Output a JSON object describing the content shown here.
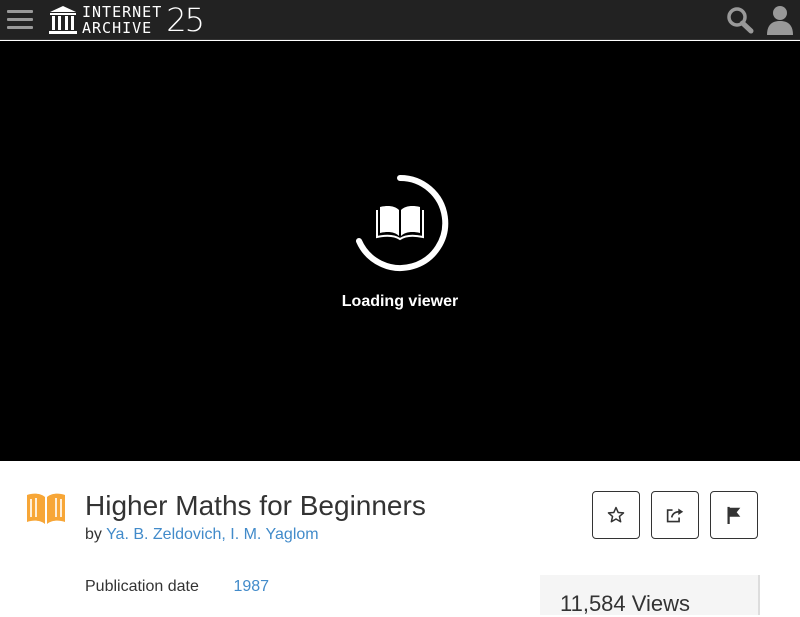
{
  "nav": {
    "logo_line1": "INTERNET",
    "logo_line2": "ARCHIVE",
    "logo_badge": "25",
    "icons": {
      "menu": "hamburger-icon",
      "search": "search-icon",
      "user": "user-icon"
    }
  },
  "viewer": {
    "status": "Loading viewer",
    "icon": "book-icon"
  },
  "item": {
    "title": "Higher Maths for Beginners",
    "by_prefix": "by",
    "authors": "Ya. B. Zeldovich, I. M. Yaglom",
    "type_icon": "texts-icon",
    "type_color": "#f7a637"
  },
  "actions": {
    "favorite_icon": "star-icon",
    "share_icon": "share-icon",
    "flag_icon": "flag-icon"
  },
  "metadata": {
    "publication_date_label": "Publication date",
    "publication_date": "1987"
  },
  "stats": {
    "views": "11,584 Views"
  },
  "colors": {
    "nav_bg": "#222222",
    "link": "#428bca",
    "viewer_bg": "#000000"
  }
}
